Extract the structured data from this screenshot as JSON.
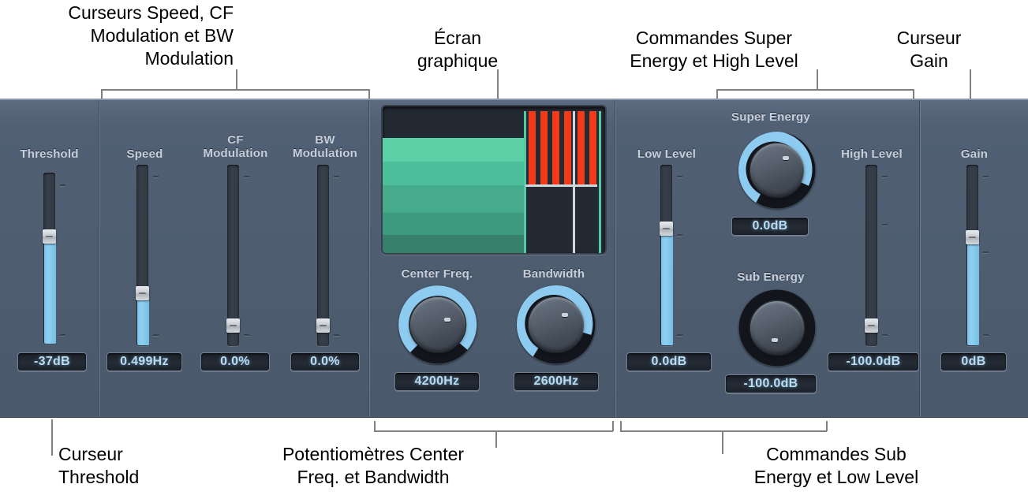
{
  "annotations": {
    "top_left": "Curseurs Speed, CF\nModulation et BW\nModulation",
    "top_display": "Écran\ngraphique",
    "top_right": "Commandes Super\nEnergy et High Level",
    "top_far_right": "Curseur\nGain",
    "bottom_left": "Curseur\nThreshold",
    "bottom_mid": "Potentiomètres Center\nFreq. et Bandwidth",
    "bottom_right": "Commandes Sub\nEnergy et Low Level"
  },
  "plugin": {
    "controls": {
      "threshold": {
        "label": "Threshold",
        "value": "-37dB"
      },
      "speed": {
        "label": "Speed",
        "value": "0.499Hz"
      },
      "cf_modulation": {
        "label": "CF\nModulation",
        "value": "0.0%"
      },
      "bw_modulation": {
        "label": "BW\nModulation",
        "value": "0.0%"
      },
      "center_freq": {
        "label": "Center Freq.",
        "value": "4200Hz"
      },
      "bandwidth": {
        "label": "Bandwidth",
        "value": "2600Hz"
      },
      "low_level": {
        "label": "Low Level",
        "value": "0.0dB"
      },
      "super_energy": {
        "label": "Super Energy",
        "value": "0.0dB"
      },
      "sub_energy": {
        "label": "Sub Energy",
        "value": "-100.0dB"
      },
      "high_level": {
        "label": "High Level",
        "value": "-100.0dB"
      },
      "gain": {
        "label": "Gain",
        "value": "0dB"
      }
    },
    "display": {
      "name": "graphic-display",
      "band_colors": [
        "#5ccfa6",
        "#4dbf9a",
        "#45ab8b",
        "#3d9a7e",
        "#367f6b"
      ],
      "red_bar_color": "#f2391a",
      "marker_color": "#cfd6dd",
      "edge_color": "#52c9a3",
      "background": "#242a33"
    },
    "theme": {
      "panel_bg": "#4e5d70",
      "slider_fill": "#8fd0f2",
      "knob_arc": "#8ecbf0",
      "readout_text": "#b9dcf2",
      "label_text": "#c6cfdb"
    }
  }
}
